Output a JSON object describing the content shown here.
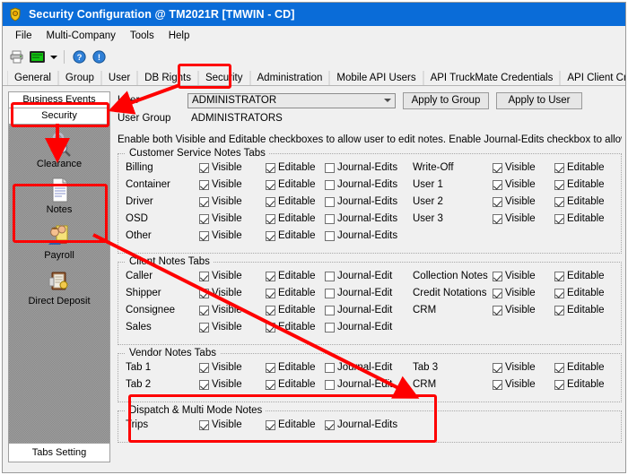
{
  "window": {
    "title": "Security Configuration @ TM2021R [TMWIN - CD]",
    "icon": "police-badge-icon"
  },
  "menubar": {
    "items": [
      {
        "label": "File"
      },
      {
        "label": "Multi-Company"
      },
      {
        "label": "Tools"
      },
      {
        "label": "Help"
      }
    ]
  },
  "toolbar": {
    "buttons": [
      {
        "name": "print-icon"
      },
      {
        "name": "display-icon"
      },
      {
        "name": "dropdown-arrow-icon"
      },
      {
        "name": "help-icon"
      },
      {
        "name": "info-icon"
      }
    ]
  },
  "tabs": {
    "items": [
      {
        "label": "General",
        "selected": false
      },
      {
        "label": "Group",
        "selected": false
      },
      {
        "label": "User",
        "selected": false
      },
      {
        "label": "DB Rights",
        "selected": false
      },
      {
        "label": "Security",
        "selected": true
      },
      {
        "label": "Administration",
        "selected": false
      },
      {
        "label": "Mobile API Users",
        "selected": false
      },
      {
        "label": "API TruckMate Credentials",
        "selected": false
      },
      {
        "label": "API Client Credentials",
        "selected": false
      }
    ]
  },
  "sidebar": {
    "header_top": "Business Events",
    "header_selected": "Security",
    "footer": "Tabs Setting",
    "items": [
      {
        "label": "Clearance",
        "icon": "padlock-magnifier-icon"
      },
      {
        "label": "Notes",
        "icon": "document-icon"
      },
      {
        "label": "Payroll",
        "icon": "people-icon"
      },
      {
        "label": "Direct Deposit",
        "icon": "bank-book-icon"
      }
    ]
  },
  "form": {
    "user_label": "User",
    "user_value": "ADMINISTRATOR",
    "user_group_label": "User Group",
    "user_group_value": "ADMINISTRATORS",
    "apply_to_group": "Apply to Group",
    "apply_to_user": "Apply to User",
    "hint": "Enable both Visible and Editable checkboxes to allow user to edit notes. Enable Journal-Edits checkbox to allow user to edit jou"
  },
  "groups": [
    {
      "title": "Customer Service Notes Tabs",
      "left_rows": [
        {
          "label": "Billing",
          "visible": true,
          "editable": true,
          "journal": false
        },
        {
          "label": "Container",
          "visible": true,
          "editable": true,
          "journal": false
        },
        {
          "label": "Driver",
          "visible": true,
          "editable": true,
          "journal": false
        },
        {
          "label": "OSD",
          "visible": true,
          "editable": true,
          "journal": false
        },
        {
          "label": "Other",
          "visible": true,
          "editable": true,
          "journal": false
        }
      ],
      "right_rows": [
        {
          "label": "Write-Off",
          "visible": true,
          "editable": true
        },
        {
          "label": "User 1",
          "visible": true,
          "editable": true
        },
        {
          "label": "User 2",
          "visible": true,
          "editable": true
        },
        {
          "label": "User 3",
          "visible": true,
          "editable": true
        }
      ],
      "visible_label": "Visible",
      "editable_label": "Editable",
      "journal_label": "Journal-Edits"
    },
    {
      "title": "Client Notes Tabs",
      "left_rows": [
        {
          "label": "Caller",
          "visible": true,
          "editable": true,
          "journal": false
        },
        {
          "label": "Shipper",
          "visible": true,
          "editable": true,
          "journal": false
        },
        {
          "label": "Consignee",
          "visible": true,
          "editable": true,
          "journal": false
        },
        {
          "label": "Sales",
          "visible": true,
          "editable": true,
          "journal": false
        }
      ],
      "right_rows": [
        {
          "label": "Collection Notes",
          "visible": true,
          "editable": true
        },
        {
          "label": "Credit Notations",
          "visible": true,
          "editable": true
        },
        {
          "label": "CRM",
          "visible": true,
          "editable": true
        }
      ],
      "visible_label": "Visible",
      "editable_label": "Editable",
      "journal_label": "Journal-Edit"
    },
    {
      "title": "Vendor Notes Tabs",
      "left_rows": [
        {
          "label": "Tab 1",
          "visible": true,
          "editable": true,
          "journal": false
        },
        {
          "label": "Tab 2",
          "visible": true,
          "editable": true,
          "journal": false
        }
      ],
      "right_rows": [
        {
          "label": "Tab 3",
          "visible": true,
          "editable": true
        },
        {
          "label": "CRM",
          "visible": true,
          "editable": true
        }
      ],
      "visible_label": "Visible",
      "editable_label": "Editable",
      "journal_label": "Journal-Edit"
    },
    {
      "title": "Dispatch & Multi Mode Notes",
      "left_rows": [
        {
          "label": "Trips",
          "visible": true,
          "editable": true,
          "journal": true
        }
      ],
      "right_rows": [],
      "visible_label": "Visible",
      "editable_label": "Editable",
      "journal_label": "Journal-Edits"
    }
  ],
  "annotations": {
    "color": "#fe0000",
    "boxes": [
      "security-tab",
      "sidebar-security",
      "sidebar-notes",
      "dispatch-group"
    ]
  }
}
